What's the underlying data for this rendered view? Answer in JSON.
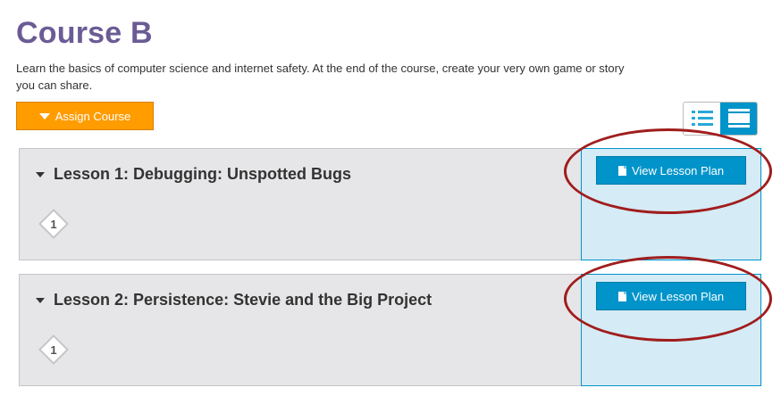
{
  "course": {
    "title": "Course B",
    "description": "Learn the basics of computer science and internet safety. At the end of the course, create your very own game or story you can share."
  },
  "toolbar": {
    "assign_label": "Assign Course",
    "view_toggle": {
      "list_icon": "list-view-icon",
      "detail_icon": "detail-view-icon",
      "selected": "detail"
    }
  },
  "lessons": [
    {
      "title": "Lesson 1: Debugging: Unspotted Bugs",
      "levels": [
        "1"
      ],
      "plan_label": "View Lesson Plan"
    },
    {
      "title": "Lesson 2: Persistence: Stevie and the Big Project",
      "levels": [
        "1"
      ],
      "plan_label": "View Lesson Plan"
    }
  ],
  "colors": {
    "title": "#6b5b95",
    "assign_button": "#ff9c00",
    "primary_blue": "#0094ca",
    "annotation_red": "#a01d1d"
  }
}
